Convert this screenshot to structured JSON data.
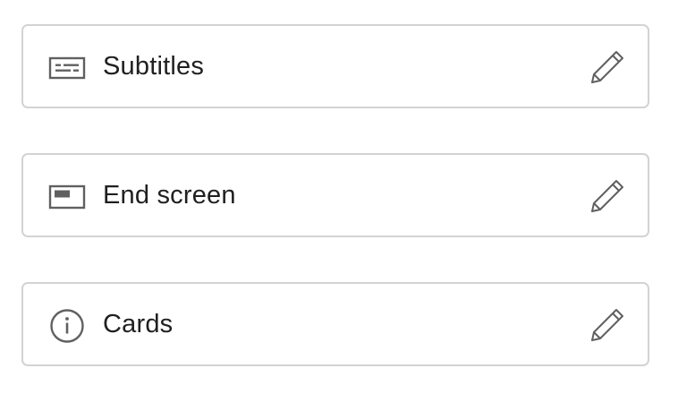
{
  "cards": [
    {
      "label": "Subtitles",
      "icon": "subtitles-icon",
      "action_icon": "pencil-icon"
    },
    {
      "label": "End screen",
      "icon": "end-screen-icon",
      "action_icon": "pencil-icon"
    },
    {
      "label": "Cards",
      "icon": "info-icon",
      "action_icon": "pencil-icon"
    }
  ],
  "colors": {
    "border": "#d3d3d3",
    "text": "#202020",
    "icon": "#606060"
  }
}
